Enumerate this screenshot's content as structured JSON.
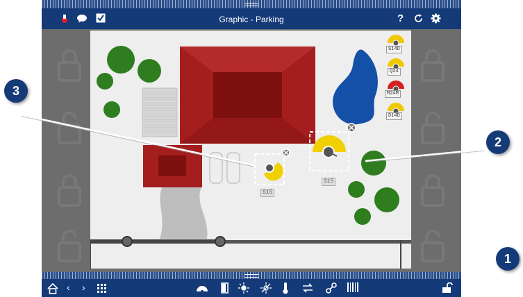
{
  "header": {
    "title": "Graphic - Parking",
    "help_label": "?"
  },
  "sensors": {
    "selected_a": {
      "label": "S15"
    },
    "selected_b": {
      "label": "S15"
    },
    "legend": [
      {
        "label": "S14D",
        "color": "#f0c800"
      },
      {
        "label": "Q24",
        "color": "#f0c800"
      },
      {
        "label": "M24M",
        "color": "#d42020"
      },
      {
        "label": "D14D",
        "color": "#f0c800"
      }
    ]
  },
  "callouts": [
    "1",
    "2",
    "3"
  ],
  "colors": {
    "header_bg": "#143a78",
    "house_roof": "#a51e1e",
    "tree": "#2e7d1f",
    "pond": "#1550a8",
    "sensor_yellow": "#f0d000"
  }
}
